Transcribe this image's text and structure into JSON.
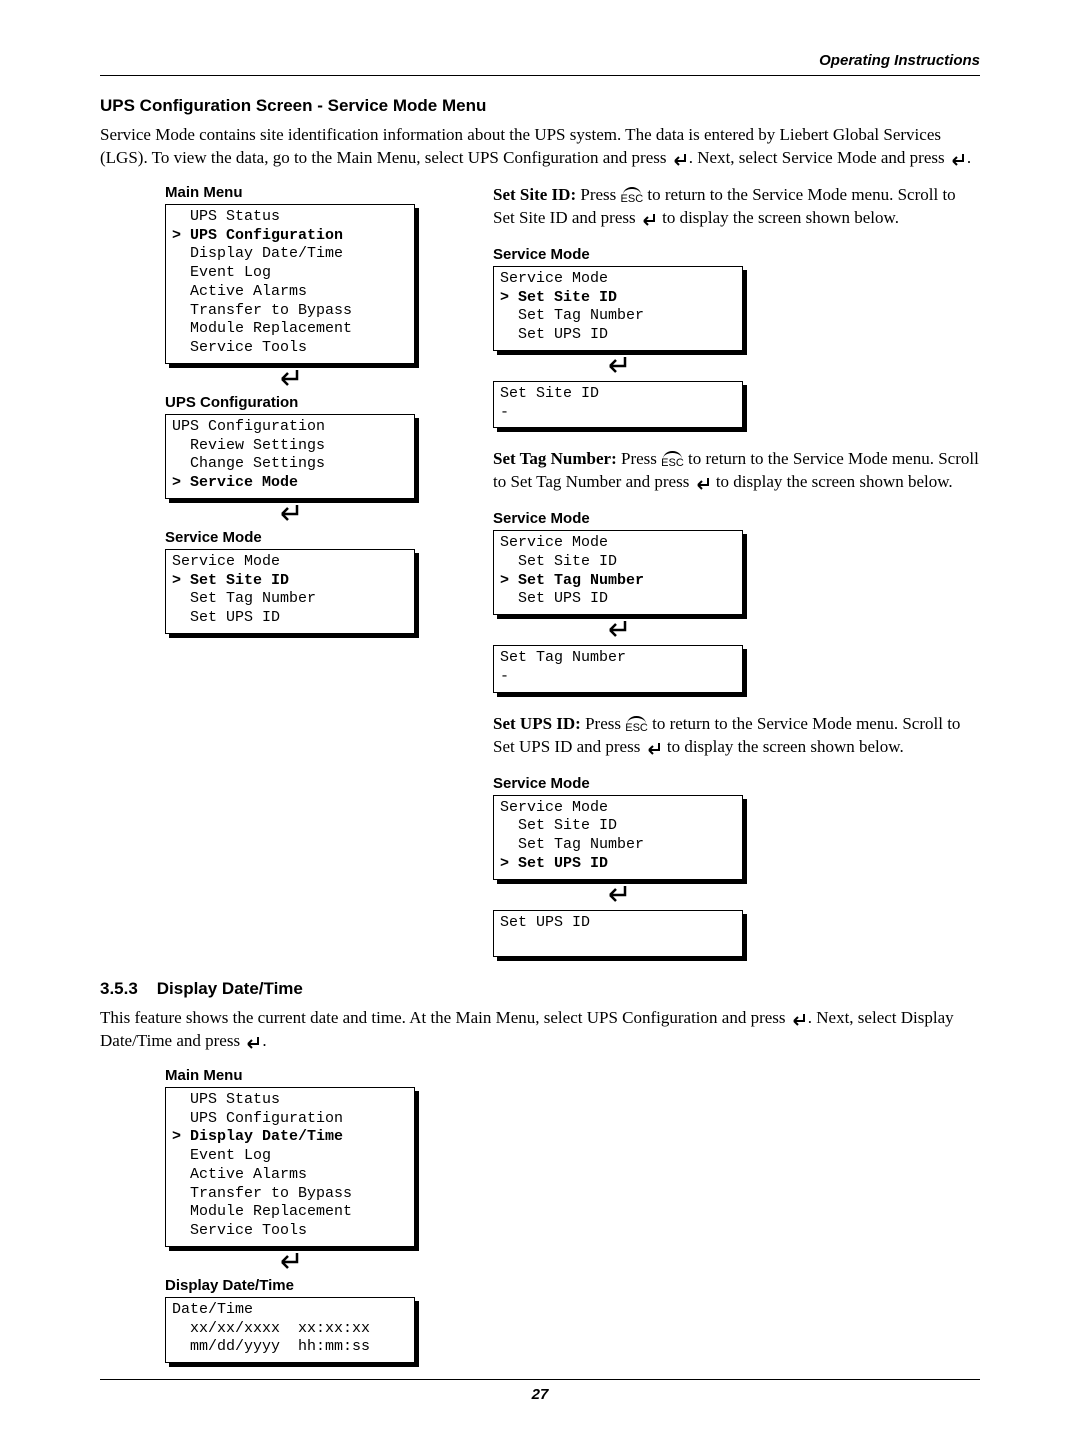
{
  "header": {
    "running": "Operating Instructions"
  },
  "section1": {
    "title": "UPS Configuration Screen - Service Mode Menu",
    "intro_a": "Service Mode contains site identification information about the UPS system. The data is entered by Liebert Global Services (LGS). To view the data, go to the Main Menu, select UPS Configuration and press ",
    "intro_b": ". Next, select Service Mode and press ",
    "intro_c": "."
  },
  "left": {
    "label_main": "Main Menu",
    "main_menu": [
      {
        "t": "  UPS Status",
        "b": false
      },
      {
        "t": "> UPS Configuration",
        "b": true
      },
      {
        "t": "  Display Date/Time",
        "b": false
      },
      {
        "t": "  Event Log",
        "b": false
      },
      {
        "t": "  Active Alarms",
        "b": false
      },
      {
        "t": "  Transfer to Bypass",
        "b": false
      },
      {
        "t": "  Module Replacement",
        "b": false
      },
      {
        "t": "  Service Tools",
        "b": false
      }
    ],
    "label_ups": "UPS Configuration",
    "ups_menu": [
      {
        "t": "UPS Configuration",
        "b": false
      },
      {
        "t": "  Review Settings",
        "b": false
      },
      {
        "t": "  Change Settings",
        "b": false
      },
      {
        "t": "> Service Mode",
        "b": true
      }
    ],
    "label_sm": "Service Mode",
    "sm_menu": [
      {
        "t": "Service Mode",
        "b": false
      },
      {
        "t": "> Set Site ID",
        "b": true
      },
      {
        "t": "  Set Tag Number",
        "b": false
      },
      {
        "t": "  Set UPS ID",
        "b": false
      }
    ]
  },
  "right": {
    "site": {
      "lead_b": "Set Site ID: ",
      "a": "Press ",
      "b": " to return to the Service Mode menu. Scroll to Set Site ID and press ",
      "c": " to display the screen shown below.",
      "label": "Service Mode",
      "menu": [
        {
          "t": "Service Mode",
          "b": false
        },
        {
          "t": "> Set Site ID",
          "b": true
        },
        {
          "t": "  Set Tag Number",
          "b": false
        },
        {
          "t": "  Set UPS ID",
          "b": false
        }
      ],
      "sub": [
        {
          "t": "Set Site ID",
          "b": false
        },
        {
          "t": "-",
          "b": false
        }
      ]
    },
    "tag": {
      "lead_b": "Set Tag Number: ",
      "a": "Press ",
      "b": " to return to the Service Mode menu. Scroll to Set Tag Number and press ",
      "c": " to display the screen shown below.",
      "label": "Service Mode",
      "menu": [
        {
          "t": "Service Mode",
          "b": false
        },
        {
          "t": "  Set Site ID",
          "b": false
        },
        {
          "t": "> Set Tag Number",
          "b": true
        },
        {
          "t": "  Set UPS ID",
          "b": false
        }
      ],
      "sub": [
        {
          "t": "Set Tag Number",
          "b": false
        },
        {
          "t": "-",
          "b": false
        }
      ]
    },
    "ups": {
      "lead_b": "Set UPS ID: ",
      "a": "Press ",
      "b": " to return to the Service Mode menu. Scroll to Set UPS ID and press ",
      "c": " to display the screen shown below.",
      "label": "Service Mode",
      "menu": [
        {
          "t": "Service Mode",
          "b": false
        },
        {
          "t": "  Set Site ID",
          "b": false
        },
        {
          "t": "  Set Tag Number",
          "b": false
        },
        {
          "t": "> Set UPS ID",
          "b": true
        }
      ],
      "sub": [
        {
          "t": "Set UPS ID",
          "b": false
        },
        {
          "t": " ",
          "b": false
        }
      ]
    }
  },
  "section2": {
    "num": "3.5.3",
    "title": "Display Date/Time",
    "intro_a": "This feature shows the current date and time. At the Main Menu, select UPS Configuration and press ",
    "intro_b": ". Next, select Display Date/Time and press ",
    "intro_c": ".",
    "label_main": "Main Menu",
    "main_menu": [
      {
        "t": "  UPS Status",
        "b": false
      },
      {
        "t": "  UPS Configuration",
        "b": false
      },
      {
        "t": "> Display Date/Time",
        "b": true
      },
      {
        "t": "  Event Log",
        "b": false
      },
      {
        "t": "  Active Alarms",
        "b": false
      },
      {
        "t": "  Transfer to Bypass",
        "b": false
      },
      {
        "t": "  Module Replacement",
        "b": false
      },
      {
        "t": "  Service Tools",
        "b": false
      }
    ],
    "label_dt": "Display Date/Time",
    "dt_menu": [
      {
        "t": "Date/Time",
        "b": false
      },
      {
        "t": "  xx/xx/xxxx  xx:xx:xx",
        "b": false
      },
      {
        "t": "  mm/dd/yyyy  hh:mm:ss",
        "b": false
      }
    ]
  },
  "esc_text": "ESC",
  "page_number": "27"
}
